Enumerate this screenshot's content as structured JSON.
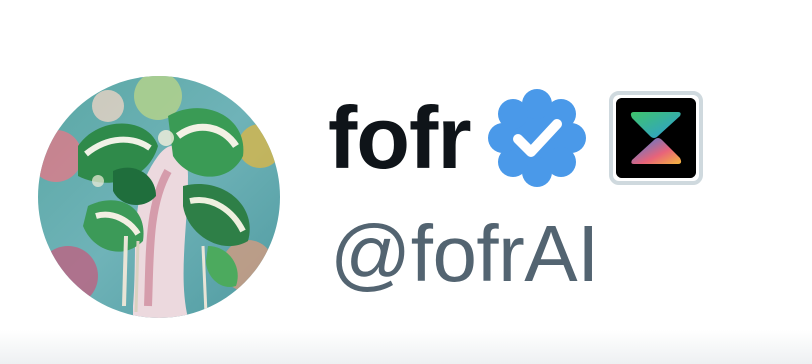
{
  "profile": {
    "display_name": "fofr",
    "handle": "@fofrAI",
    "avatar_icon": "monstera-plant-painting-avatar",
    "verified_icon": "verified-badge-icon",
    "affiliate_icon": "affiliate-logo-icon"
  },
  "colors": {
    "name": "#0f1419",
    "handle": "#536471",
    "verified_blue": "#4a99e9",
    "badge_border": "#cfd9de"
  }
}
